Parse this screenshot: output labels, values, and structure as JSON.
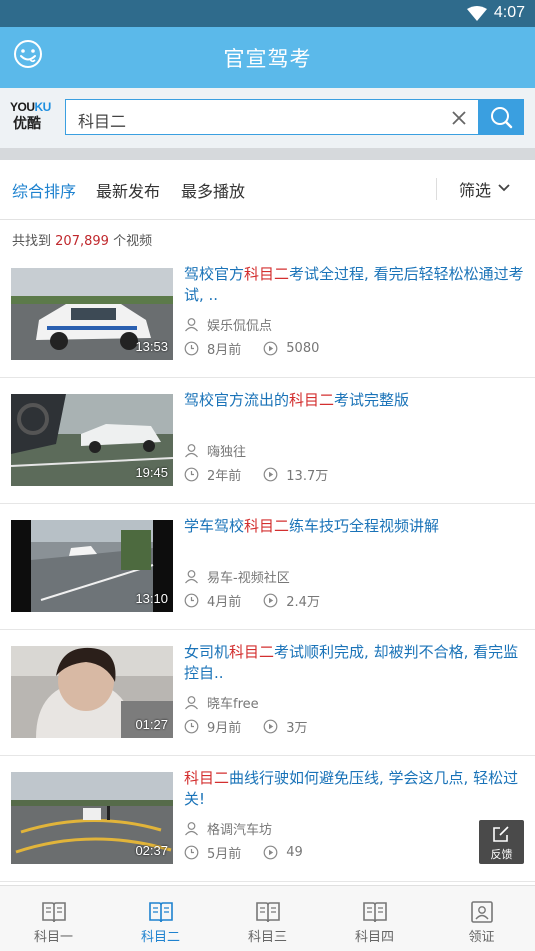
{
  "status_bar": {
    "time": "4:07"
  },
  "app_bar": {
    "title": "官宣驾考"
  },
  "search": {
    "logo_top_a": "YOU",
    "logo_top_b": "KU",
    "logo_bottom": "优酷",
    "query": "科目二"
  },
  "sort": {
    "tabs": [
      "综合排序",
      "最新发布",
      "最多播放"
    ],
    "active_tab": "综合排序",
    "filter_label": "筛选"
  },
  "results": {
    "prefix": "共找到",
    "count": "207,899",
    "suffix": "个视频"
  },
  "videos": [
    {
      "title_pre": "驾校官方",
      "title_hl": "科目二",
      "title_post": "考试全过程, 看完后轻轻松松通过考试, ..",
      "author": "娱乐侃侃点",
      "age": "8月前",
      "plays": "5080",
      "duration": "13:53"
    },
    {
      "title_pre": "驾校官方流出的",
      "title_hl": "科目二",
      "title_post": "考试完整版",
      "author": "嗨独往",
      "age": "2年前",
      "plays": "13.7万",
      "duration": "19:45"
    },
    {
      "title_pre": "学车驾校",
      "title_hl": "科目二",
      "title_post": "练车技巧全程视频讲解",
      "author": "易车-视频社区",
      "age": "4月前",
      "plays": "2.4万",
      "duration": "13:10"
    },
    {
      "title_pre": "女司机",
      "title_hl": "科目二",
      "title_post": "考试顺利完成, 却被判不合格, 看完监控自..",
      "author": "晓车free",
      "age": "9月前",
      "plays": "3万",
      "duration": "01:27"
    },
    {
      "title_pre": "",
      "title_hl": "科目二",
      "title_post": "曲线行驶如何避免压线, 学会这几点, 轻松过关!",
      "author": "格调汽车坊",
      "age": "5月前",
      "plays": "49",
      "duration": "02:37"
    }
  ],
  "feedback_label": "反馈",
  "bottom_nav": [
    {
      "label": "科目一",
      "icon": "book-icon"
    },
    {
      "label": "科目二",
      "icon": "book-icon"
    },
    {
      "label": "科目三",
      "icon": "book-icon"
    },
    {
      "label": "科目四",
      "icon": "book-icon"
    },
    {
      "label": "领证",
      "icon": "id-card-icon"
    }
  ],
  "active_nav": "科目二",
  "colors": {
    "app_bar": "#5bb9ea",
    "accent": "#1e82cf",
    "highlight": "#d32f2f",
    "status_bar": "#2f6b8c"
  }
}
